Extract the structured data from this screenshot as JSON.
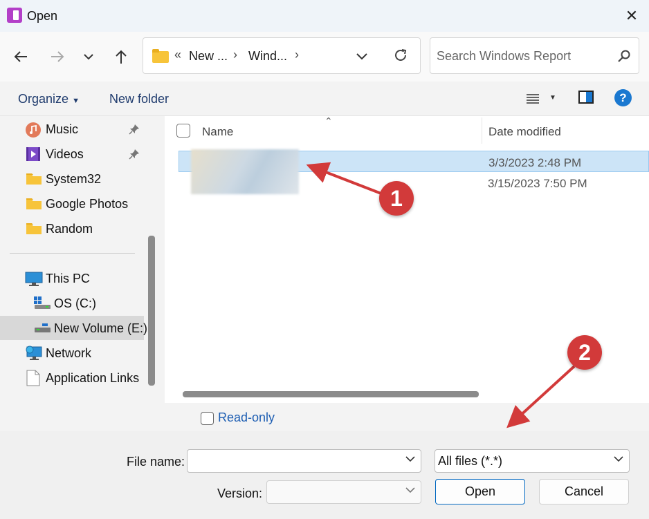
{
  "window": {
    "title": "Open",
    "close_glyph": "✕"
  },
  "nav": {
    "address_crumbs": [
      "New ...",
      "Wind..."
    ],
    "address_overflow": "«",
    "search_placeholder": "Search Windows Report"
  },
  "toolbar": {
    "organize": "Organize",
    "new_folder": "New folder",
    "help": "?"
  },
  "sidebar": {
    "items": [
      {
        "label": "Music",
        "icon": "music-icon",
        "pinned": true
      },
      {
        "label": "Videos",
        "icon": "videos-icon",
        "pinned": true
      },
      {
        "label": "System32",
        "icon": "folder-icon"
      },
      {
        "label": "Google Photos",
        "icon": "folder-icon"
      },
      {
        "label": "Random",
        "icon": "folder-icon"
      },
      {
        "label": "This PC",
        "icon": "pc-icon"
      },
      {
        "label": "OS (C:)",
        "icon": "drive-icon"
      },
      {
        "label": "New Volume (E:)",
        "icon": "drive-icon",
        "selected": true
      },
      {
        "label": "Network",
        "icon": "network-icon"
      },
      {
        "label": "Application Links",
        "icon": "document-icon"
      }
    ]
  },
  "files": {
    "columns": {
      "name": "Name",
      "date_modified": "Date modified"
    },
    "rows": [
      {
        "date": "3/3/2023 2:48 PM",
        "selected": true
      },
      {
        "date": "3/15/2023 7:50 PM",
        "selected": false
      }
    ]
  },
  "options": {
    "read_only": "Read-only"
  },
  "bottom": {
    "file_name_label": "File name:",
    "file_name_value": "",
    "version_label": "Version:",
    "version_value": "",
    "file_type": "All files (*.*)",
    "open": "Open",
    "cancel": "Cancel"
  },
  "annotations": {
    "badge_1": "1",
    "badge_2": "2",
    "color": "#d23a3a"
  },
  "colors": {
    "accent": "#0067c0",
    "selection": "#cce4f7",
    "help": "#1a78d0"
  }
}
